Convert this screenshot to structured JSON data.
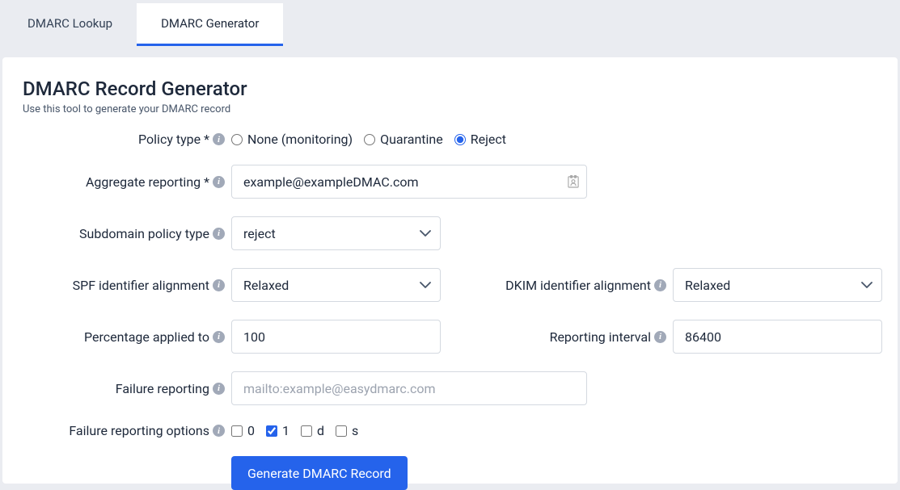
{
  "tabs": {
    "lookup": "DMARC Lookup",
    "generator": "DMARC Generator"
  },
  "page": {
    "title": "DMARC Record Generator",
    "subtitle": "Use this tool to generate your DMARC record"
  },
  "labels": {
    "policy_type": "Policy type *",
    "aggregate_reporting": "Aggregate reporting *",
    "subdomain_policy": "Subdomain policy type",
    "spf_alignment": "SPF identifier alignment",
    "dkim_alignment": "DKIM identifier alignment",
    "percentage": "Percentage applied to",
    "reporting_interval": "Reporting interval",
    "failure_reporting": "Failure reporting",
    "failure_options": "Failure reporting options"
  },
  "policy": {
    "none": "None (monitoring)",
    "quarantine": "Quarantine",
    "reject": "Reject",
    "selected": "reject"
  },
  "aggregate_value": "example@exampleDMAC.com",
  "subdomain_value": "reject",
  "spf_value": "Relaxed",
  "dkim_value": "Relaxed",
  "percentage_value": "100",
  "interval_value": "86400",
  "failure_placeholder": "mailto:example@easydmarc.com",
  "checkboxes": {
    "opt0": "0",
    "opt1": "1",
    "optd": "d",
    "opts": "s"
  },
  "button": "Generate DMARC Record"
}
